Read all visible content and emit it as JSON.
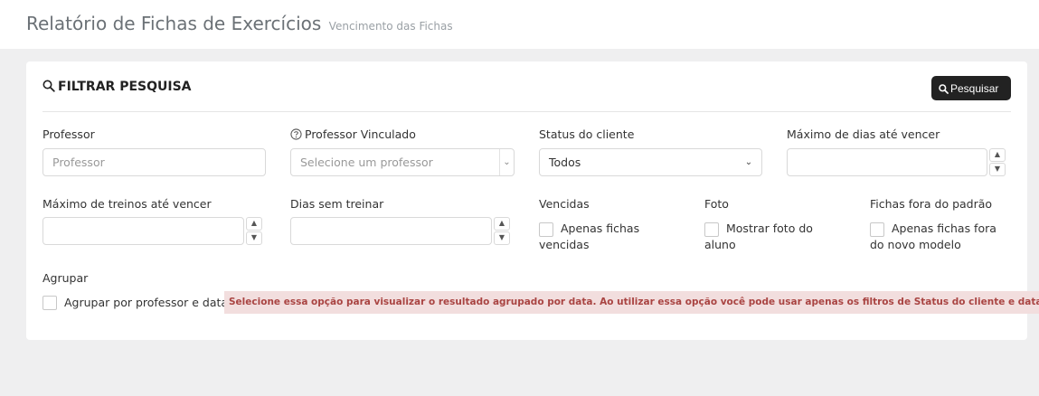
{
  "header": {
    "title": "Relatório de Fichas de Exercícios",
    "subtitle": "Vencimento das Fichas"
  },
  "filter": {
    "title": "FILTRAR PESQUISA",
    "search_button": "Pesquisar"
  },
  "fields": {
    "professor": {
      "label": "Professor",
      "placeholder": "Professor"
    },
    "professor_vinculado": {
      "label": "Professor Vinculado",
      "placeholder": "Selecione um professor"
    },
    "status_cliente": {
      "label": "Status do cliente",
      "value": "Todos"
    },
    "max_dias": {
      "label": "Máximo de dias até vencer",
      "value": ""
    },
    "max_treinos": {
      "label": "Máximo de treinos até vencer",
      "value": ""
    },
    "dias_sem_treinar": {
      "label": "Dias sem treinar",
      "value": ""
    },
    "vencidas": {
      "label": "Vencidas",
      "option": "Apenas fichas vencidas",
      "line1": "Apenas fichas",
      "line2": "vencidas",
      "checked": false
    },
    "foto": {
      "label": "Foto",
      "option": "Mostrar foto do aluno",
      "line1": "Mostrar foto do",
      "line2": "aluno",
      "checked": false
    },
    "fora_padrao": {
      "label": "Fichas fora do padrão",
      "option": "Apenas fichas fora do novo modelo",
      "line1": "Apenas fichas fora",
      "line2": "do novo modelo",
      "checked": false
    },
    "agrupar": {
      "label": "Agrupar",
      "option": "Agrupar por professor e data.",
      "checked": false,
      "alert": "Selecione essa opção para visualizar o resultado agrupado por data. Ao utilizar essa opção você pode usar apenas os filtros de Status do cliente e data."
    }
  },
  "icons": {
    "search": "search-icon",
    "help": "question-circle-icon",
    "chevron": "chevron-down-icon"
  },
  "colors": {
    "button_bg": "#222222",
    "alert_bg": "#f2dede",
    "alert_text": "#a94442"
  }
}
